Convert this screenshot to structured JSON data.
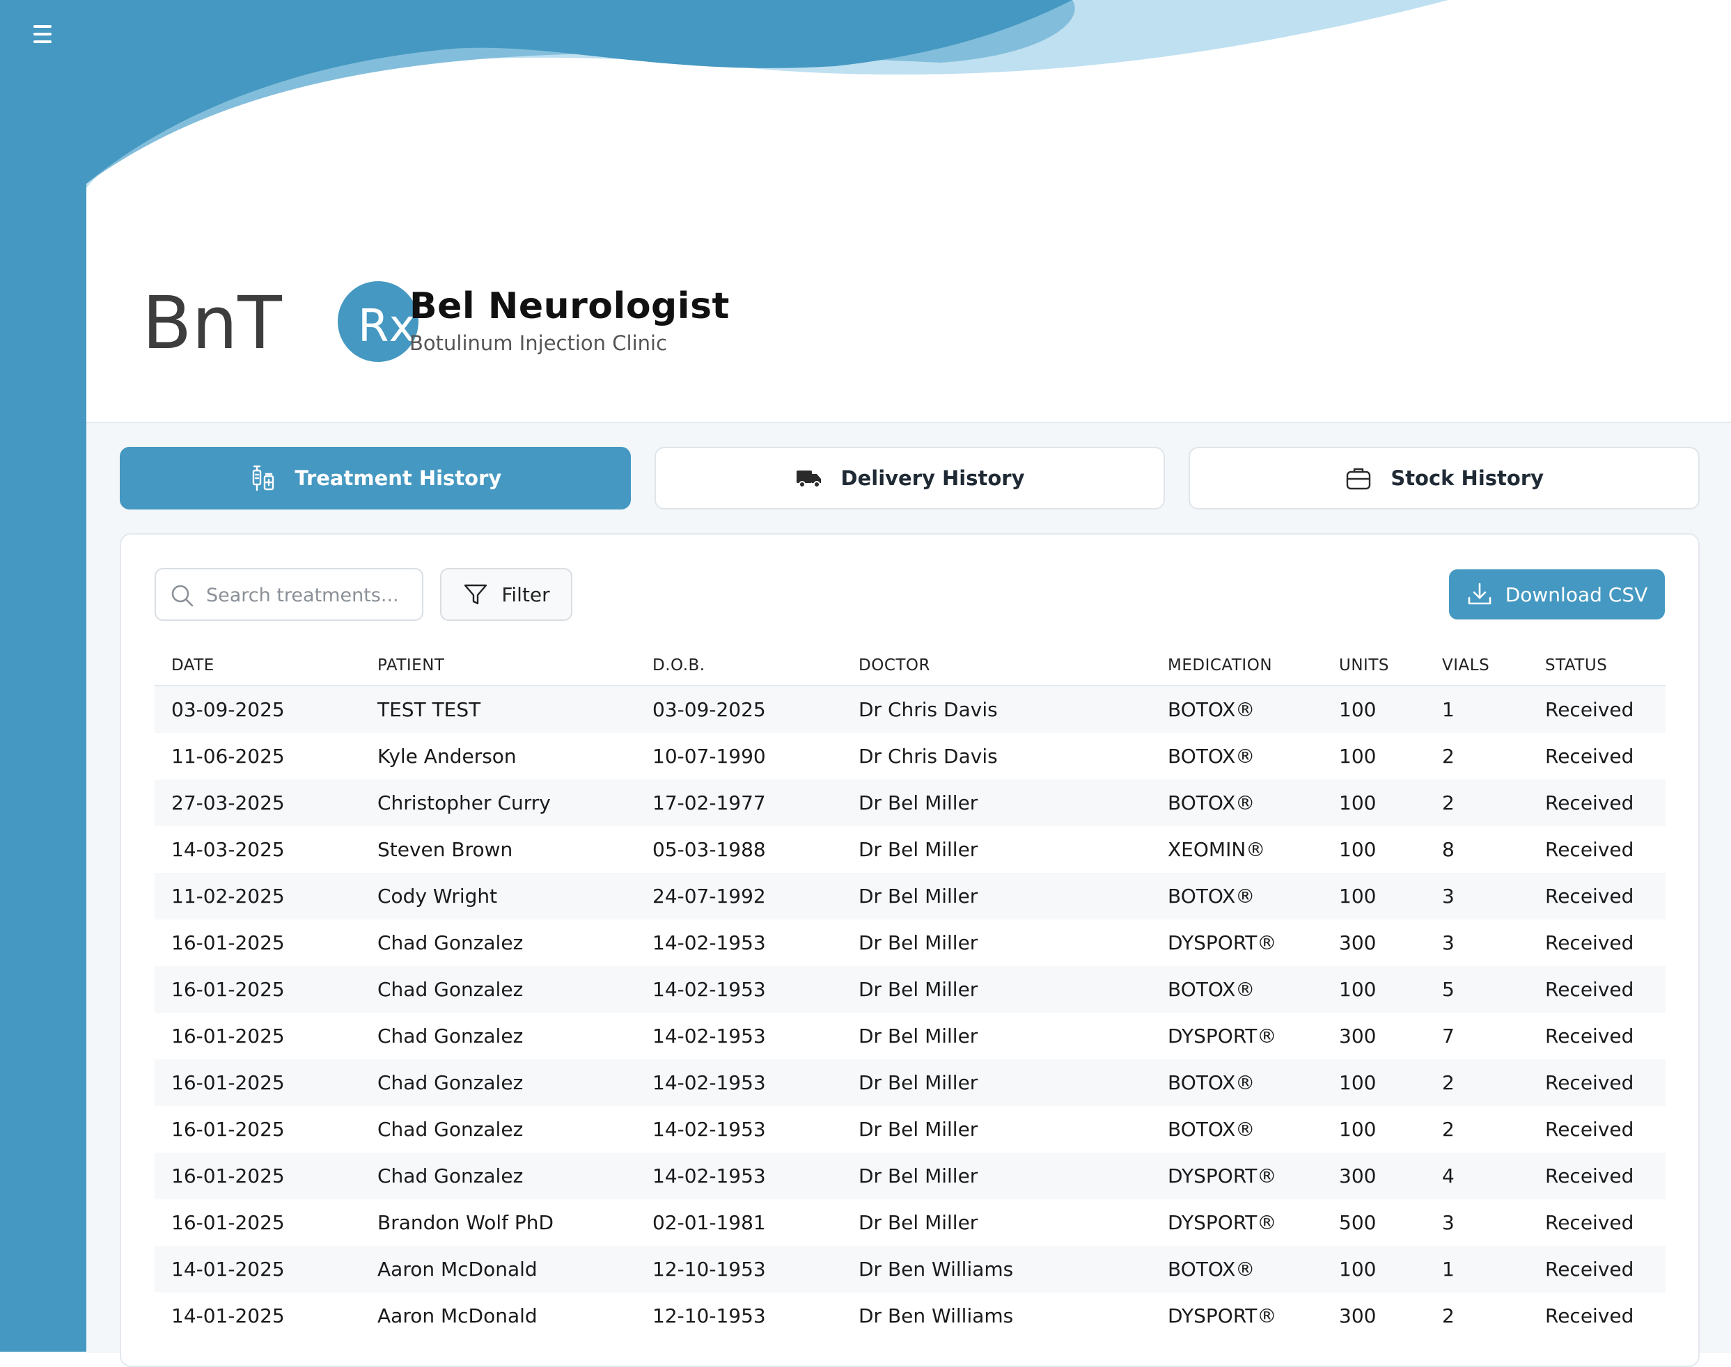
{
  "brand": {
    "logo_text": "BnT",
    "logo_badge": "Rx",
    "clinic_name": "Bel Neurologist",
    "clinic_subtitle": "Botulinum Injection Clinic",
    "primary_color": "#4598c1",
    "light_wave_color": "#bfe0f0"
  },
  "tabs": [
    {
      "label": "Treatment History",
      "icon": "syringe-vial-icon",
      "active": true
    },
    {
      "label": "Delivery History",
      "icon": "truck-icon",
      "active": false
    },
    {
      "label": "Stock History",
      "icon": "briefcase-icon",
      "active": false
    }
  ],
  "toolbar": {
    "search_placeholder": "Search treatments...",
    "filter_label": "Filter",
    "download_label": "Download CSV"
  },
  "table": {
    "columns": [
      "DATE",
      "PATIENT",
      "D.O.B.",
      "DOCTOR",
      "MEDICATION",
      "UNITS",
      "VIALS",
      "STATUS"
    ],
    "rows": [
      [
        "03-09-2025",
        "TEST TEST",
        "03-09-2025",
        "Dr Chris Davis",
        "BOTOX®",
        "100",
        "1",
        "Received"
      ],
      [
        "11-06-2025",
        "Kyle Anderson",
        "10-07-1990",
        "Dr Chris Davis",
        "BOTOX®",
        "100",
        "2",
        "Received"
      ],
      [
        "27-03-2025",
        "Christopher Curry",
        "17-02-1977",
        "Dr Bel Miller",
        "BOTOX®",
        "100",
        "2",
        "Received"
      ],
      [
        "14-03-2025",
        "Steven Brown",
        "05-03-1988",
        "Dr Bel Miller",
        "XEOMIN®",
        "100",
        "8",
        "Received"
      ],
      [
        "11-02-2025",
        "Cody Wright",
        "24-07-1992",
        "Dr Bel Miller",
        "BOTOX®",
        "100",
        "3",
        "Received"
      ],
      [
        "16-01-2025",
        "Chad Gonzalez",
        "14-02-1953",
        "Dr Bel Miller",
        "DYSPORT®",
        "300",
        "3",
        "Received"
      ],
      [
        "16-01-2025",
        "Chad Gonzalez",
        "14-02-1953",
        "Dr Bel Miller",
        "BOTOX®",
        "100",
        "5",
        "Received"
      ],
      [
        "16-01-2025",
        "Chad Gonzalez",
        "14-02-1953",
        "Dr Bel Miller",
        "DYSPORT®",
        "300",
        "7",
        "Received"
      ],
      [
        "16-01-2025",
        "Chad Gonzalez",
        "14-02-1953",
        "Dr Bel Miller",
        "BOTOX®",
        "100",
        "2",
        "Received"
      ],
      [
        "16-01-2025",
        "Chad Gonzalez",
        "14-02-1953",
        "Dr Bel Miller",
        "BOTOX®",
        "100",
        "2",
        "Received"
      ],
      [
        "16-01-2025",
        "Chad Gonzalez",
        "14-02-1953",
        "Dr Bel Miller",
        "DYSPORT®",
        "300",
        "4",
        "Received"
      ],
      [
        "16-01-2025",
        "Brandon Wolf PhD",
        "02-01-1981",
        "Dr Bel Miller",
        "DYSPORT®",
        "500",
        "3",
        "Received"
      ],
      [
        "14-01-2025",
        "Aaron McDonald",
        "12-10-1953",
        "Dr Ben Williams",
        "BOTOX®",
        "100",
        "1",
        "Received"
      ],
      [
        "14-01-2025",
        "Aaron McDonald",
        "12-10-1953",
        "Dr Ben Williams",
        "DYSPORT®",
        "300",
        "2",
        "Received"
      ]
    ]
  }
}
